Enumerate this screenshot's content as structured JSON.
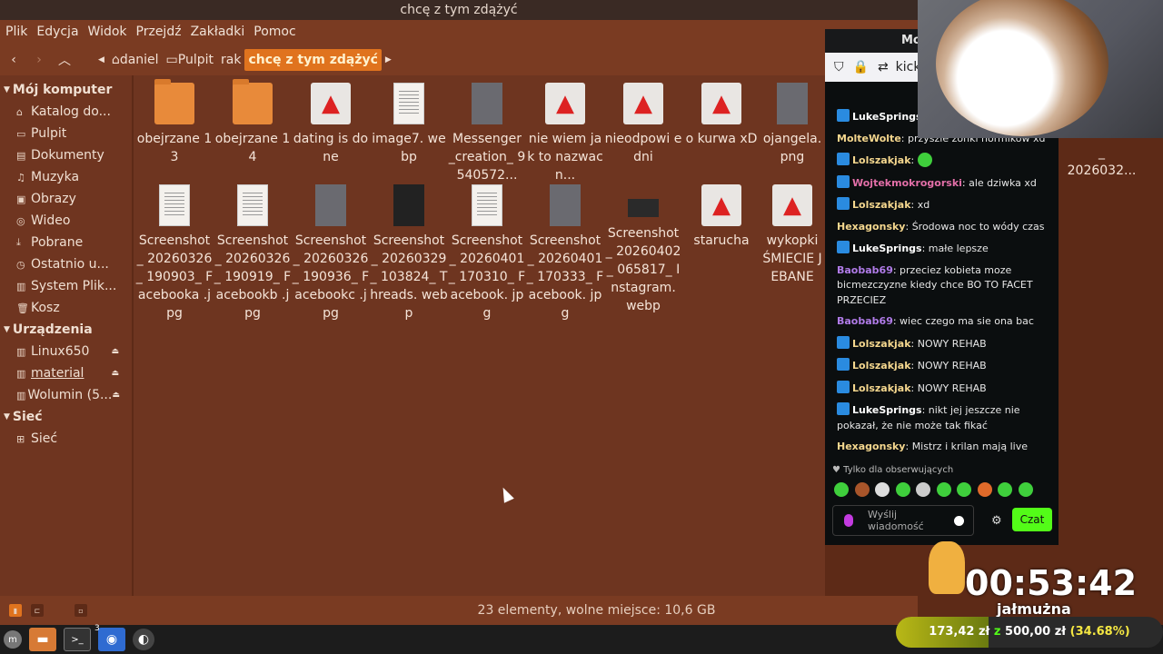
{
  "window_title": "chcę z tym zdążyć",
  "menu": [
    "Plik",
    "Edycja",
    "Widok",
    "Przejdź",
    "Zakładki",
    "Pomoc"
  ],
  "toolbar": {
    "back_icon": "chevron-left-icon",
    "forward_icon": "chevron-right-icon",
    "up_icon": "chevron-up-icon",
    "crumbs": [
      "daniel",
      "Pulpit",
      "rak",
      "chcę z tym zdążyć"
    ]
  },
  "sidebar": {
    "computer_title": "Mój komputer",
    "computer_items": [
      "Katalog do...",
      "Pulpit",
      "Dokumenty",
      "Muzyka",
      "Obrazy",
      "Wideo",
      "Pobrane",
      "Ostatnio u...",
      "System Plik...",
      "Kosz"
    ],
    "devices_title": "Urządzenia",
    "devices_items": [
      "Linux650",
      "material",
      "Wolumin (5..."
    ],
    "network_title": "Sieć",
    "network_items": [
      "Sieć"
    ]
  },
  "files": [
    {
      "name": "obejrzane 13",
      "type": "folder"
    },
    {
      "name": "obejrzane 14",
      "type": "folder"
    },
    {
      "name": "dating is done",
      "type": "rocket"
    },
    {
      "name": "image7. webp",
      "type": "doc"
    },
    {
      "name": "Messenger _creation_ 9540572...",
      "type": "photo"
    },
    {
      "name": "nie wiem jak to nazwac n...",
      "type": "rocket"
    },
    {
      "name": "nieodpowi edni",
      "type": "rocket"
    },
    {
      "name": "o kurwa xD",
      "type": "rocket"
    },
    {
      "name": "ojangela. png",
      "type": "photo"
    },
    {
      "name": "Screenshot _ 20260326_ 190903_ Facebooka .jpg",
      "type": "doc"
    },
    {
      "name": "Screenshot _ 20260326_ 190919_ Facebookb .jpg",
      "type": "doc"
    },
    {
      "name": "Screenshot _ 20260326_ 190936_ Facebookc .jpg",
      "type": "photo"
    },
    {
      "name": "Screenshot _ 20260329_ 103824_ Threads. webp",
      "type": "photo"
    },
    {
      "name": "Screenshot _ 20260401_ 170310_ Facebook. jpg",
      "type": "doc"
    },
    {
      "name": "Screenshot _ 20260401_ 170333_ Facebook. jpg",
      "type": "photo"
    },
    {
      "name": "Screenshot _ 20260402_ 065817_ Instagram. webp",
      "type": "photo"
    },
    {
      "name": "starucha",
      "type": "rocket"
    },
    {
      "name": "wykopki ŚMIECIE JEBANE",
      "type": "rocket"
    }
  ],
  "extra_partial": "_ 2026032...",
  "status_text": "23 elementy, wolne miejsce: 10,6 GB",
  "chat": {
    "header": "Mo",
    "url": "kick",
    "messages": [
      {
        "user": "LukeSprings",
        "text": "",
        "color": "#ffffff",
        "badge": true
      },
      {
        "user": "MolteWolte",
        "text": "przyszle zonki normikow xd",
        "color": "#f5d78e",
        "badge": false
      },
      {
        "user": "Lolszakjak",
        "text": "",
        "color": "#f5d78e",
        "badge": true
      },
      {
        "user": "Wojtekmokrogorski",
        "text": "ale dziwka xd",
        "color": "#e36fa8",
        "badge": true
      },
      {
        "user": "Lolszakjak",
        "text": "xd",
        "color": "#f5d78e",
        "badge": true
      },
      {
        "user": "Hexagonsky",
        "text": "Środowa noc to wódy czas",
        "color": "#f5d78e",
        "badge": false
      },
      {
        "user": "LukeSprings",
        "text": "małe lepsze",
        "color": "#ffffff",
        "badge": true
      },
      {
        "user": "Baobab69",
        "text": "przeciez kobieta moze bicmezczyzne kiedy chce BO TO FACET PRZECIEZ",
        "color": "#b07be8",
        "badge": false
      },
      {
        "user": "Baobab69",
        "text": "wiec czego ma sie ona bac",
        "color": "#b07be8",
        "badge": false
      },
      {
        "user": "Lolszakjak",
        "text": "NOWY REHAB",
        "color": "#f5d78e",
        "badge": true
      },
      {
        "user": "Lolszakjak",
        "text": "NOWY REHAB",
        "color": "#f5d78e",
        "badge": true
      },
      {
        "user": "Lolszakjak",
        "text": "NOWY REHAB",
        "color": "#f5d78e",
        "badge": true
      },
      {
        "user": "LukeSprings",
        "text": "nikt jej jeszcze nie pokazał, że nie może tak fikać",
        "color": "#ffffff",
        "badge": true
      },
      {
        "user": "Hexagonsky",
        "text": "Mistrz i krilan mają live",
        "color": "#f5d78e",
        "badge": false
      }
    ],
    "followers_only": "Tylko dla obserwujących",
    "input_placeholder": "Wyślij wiadomość",
    "send_label": "Czat"
  },
  "overlay": {
    "timer": "00:53:42",
    "goal_label": "jałmużna",
    "goal_current": "173,42 zł",
    "goal_sep": "z",
    "goal_target": "500,00 zł",
    "goal_percent": "(34.68%)",
    "goal_fraction": 0.3468
  },
  "taskbar": {
    "badge": "3"
  }
}
